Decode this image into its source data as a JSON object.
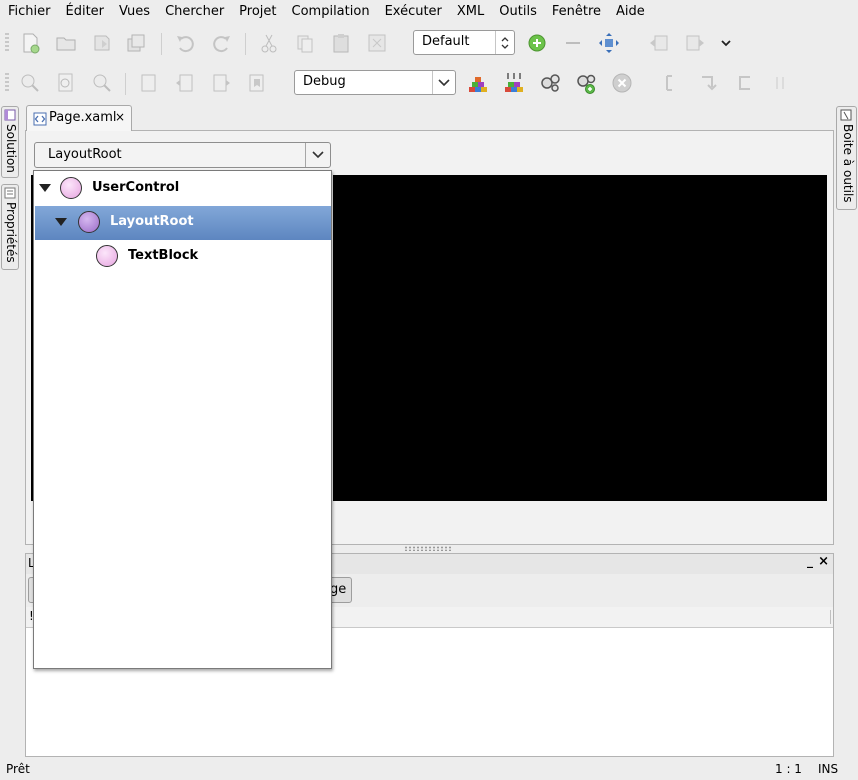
{
  "menu": [
    "Fichier",
    "Éditer",
    "Vues",
    "Chercher",
    "Projet",
    "Compilation",
    "Exécuter",
    "XML",
    "Outils",
    "Fenêtre",
    "Aide"
  ],
  "toolbar": {
    "layout_combo": "Default",
    "config_combo": "Debug"
  },
  "side_left": {
    "solution_label": "Solution",
    "properties_label": "Propriétés"
  },
  "side_right": {
    "toolbox_label": "Boite à outils"
  },
  "document": {
    "tab_label": "Page.xaml",
    "tab_close": "×",
    "nav_selected": "LayoutRoot"
  },
  "tree": [
    {
      "label": "UserControl",
      "level": 0,
      "expanded": true,
      "selected": false
    },
    {
      "label": "LayoutRoot",
      "level": 1,
      "expanded": true,
      "selected": true
    },
    {
      "label": "TextBlock",
      "level": 2,
      "expanded": false,
      "selected": false
    }
  ],
  "pad": {
    "title_fragment": "L",
    "minimize": "_",
    "close": "×",
    "button_fragment": "age",
    "column_fragment": "!"
  },
  "status": {
    "message": "Prêt",
    "position": "1 : 1",
    "mode": "INS"
  },
  "colors": {
    "selection": "#6a91c8",
    "canvas": "#000000",
    "node_pink": "#f0b8ec",
    "node_purple": "#b58ad8"
  }
}
